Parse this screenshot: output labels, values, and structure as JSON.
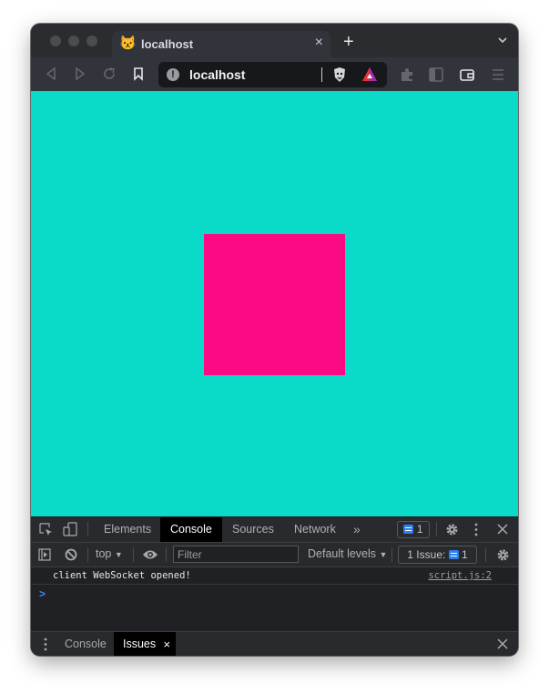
{
  "browser": {
    "tab": {
      "title": "localhost",
      "favicon": "😾",
      "close_glyph": "×"
    },
    "new_tab_glyph": "+",
    "url": "localhost",
    "info_glyph": "!"
  },
  "page": {
    "background_color": "#0adbc9",
    "square_color": "#fb0a84"
  },
  "devtools": {
    "tabs": [
      {
        "label": "Elements",
        "active": false
      },
      {
        "label": "Console",
        "active": true
      },
      {
        "label": "Sources",
        "active": false
      },
      {
        "label": "Network",
        "active": false
      }
    ],
    "more_tabs_glyph": "»",
    "message_count": "1",
    "console_bar": {
      "context": "top",
      "filter_placeholder": "Filter",
      "levels": "Default levels",
      "issues_label": "1 Issue:",
      "issues_count": "1"
    },
    "logs": [
      {
        "message": "client WebSocket opened!",
        "source": "script.js:2"
      }
    ],
    "prompt_glyph": ">",
    "drawer": {
      "tabs": [
        {
          "label": "Console",
          "active": false
        },
        {
          "label": "Issues",
          "active": true,
          "close_glyph": "×"
        }
      ]
    }
  }
}
